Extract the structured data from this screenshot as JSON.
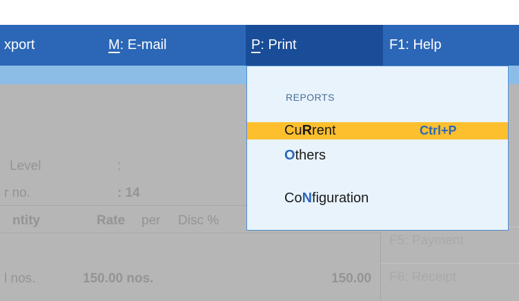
{
  "menubar": {
    "items": [
      {
        "key": "",
        "label": "xport"
      },
      {
        "key": "M",
        "label": "E-mail"
      },
      {
        "key": "P",
        "label": "Print"
      },
      {
        "key": "F1",
        "label": "Help"
      }
    ]
  },
  "background": {
    "level_label": "Level",
    "level_colon": ":",
    "no_label": "r no.",
    "no_value": ": 14",
    "columns": {
      "quantity": "ntity",
      "rate": "Rate",
      "per": "per",
      "disc": "Disc %"
    },
    "row": {
      "quantity": "l nos.",
      "rate": "150.00 nos.",
      "amount": "150.00"
    },
    "fkeys": [
      {
        "key": "F5",
        "label": "Payment"
      },
      {
        "key": "F6",
        "label": "Receipt"
      }
    ]
  },
  "print_menu": {
    "title": "REPORTS",
    "items": [
      {
        "pre": "Cu",
        "hotkey": "R",
        "post": "rent",
        "shortcut": "Ctrl+P"
      },
      {
        "pre": "",
        "hotkey": "O",
        "post": "thers"
      },
      {
        "pre": "Co",
        "hotkey": "N",
        "post": "figuration"
      }
    ]
  },
  "colors": {
    "menubar": "#2c67b7",
    "active_menu": "#1a4d98",
    "highlight": "#fdbf2d",
    "hotkey": "#2c67b7"
  }
}
